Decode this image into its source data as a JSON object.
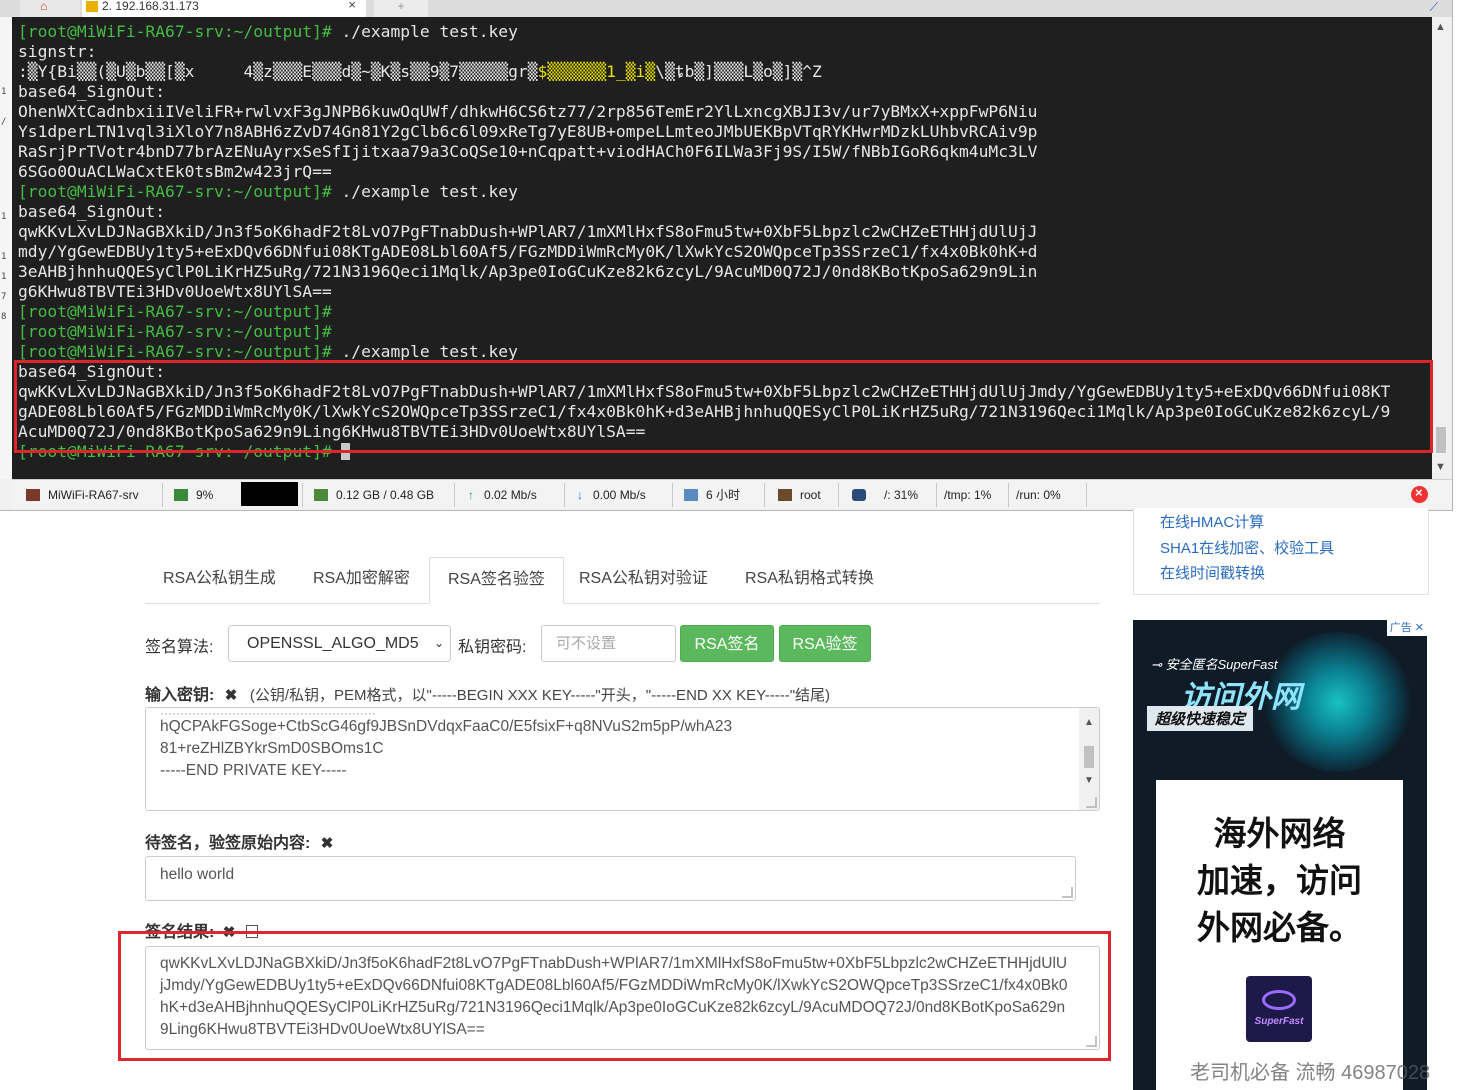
{
  "terminal": {
    "tab_title": "2. 192.168.31.173",
    "new_tab_glyph": "+",
    "lines": [
      [
        {
          "t": "[root@MiWiFi-RA67-srv:~/output]#",
          "c": "prompt"
        },
        {
          "t": " ./example test.key",
          "c": ""
        }
      ],
      [
        {
          "t": "signstr:",
          "c": ""
        }
      ],
      [
        {
          "t": ":▒Y{Bi▒▒(▒U▒b▒▒[▒x     4▒z▒▒▒E▒▒▒d▒~▒K▒s▒▒9▒7▒▒▒▒▒gr▒",
          "c": ""
        },
        {
          "t": "$▒▒▒▒▒▒1_▒i▒",
          "c": "hl"
        },
        {
          "t": "\\▒ȶb▒]▒▒▒L▒o▒]▒^Z",
          "c": ""
        }
      ],
      [
        {
          "t": "base64_SignOut:",
          "c": ""
        }
      ],
      [
        {
          "t": "OhenWXtCadnbxiiIVeliFR+rwlvxF3gJNPB6kuwOqUWf/dhkwH6CS6tz77/2rp856TemEr2YlLxncgXBJI3v/ur7yBMxX+xppFwP6Niu",
          "c": ""
        }
      ],
      [
        {
          "t": "Ys1dperLTN1vql3iXloY7n8ABH6zZvD74Gn81Y2gClb6c6l09xReTg7yE8UB+ompeLLmteoJMbUEKBpVTqRYKHwrMDzkLUhbvRCAiv9p",
          "c": ""
        }
      ],
      [
        {
          "t": "RaSrjPrTVotr4bnD77brAzENuAyrxSeSfIjitxaa79a3CoQSe10+nCqpatt+viodHACh0F6ILWa3Fj9S/I5W/fNBbIGoR6qkm4uMc3LV",
          "c": ""
        }
      ],
      [
        {
          "t": "6SGo0OuACLWaCxtEk0tsBm2w423jrQ==",
          "c": ""
        }
      ],
      [
        {
          "t": "[root@MiWiFi-RA67-srv:~/output]#",
          "c": "prompt"
        },
        {
          "t": " ./example test.key",
          "c": ""
        }
      ],
      [
        {
          "t": "base64_SignOut:",
          "c": ""
        }
      ],
      [
        {
          "t": "qwKKvLXvLDJNaGBXkiD/Jn3f5oK6hadF2t8LvO7PgFTnabDush+WPlAR7/1mXMlHxfS8oFmu5tw+0XbF5Lbpzlc2wCHZeETHHjdUlUjJ",
          "c": ""
        }
      ],
      [
        {
          "t": "mdy/YgGewEDBUy1ty5+eExDQv66DNfui08KTgADE08Lbl60Af5/FGzMDDiWmRcMy0K/lXwkYcS2OWQpceTp3SSrzeC1/fx4x0Bk0hK+d",
          "c": ""
        }
      ],
      [
        {
          "t": "3eAHBjhnhuQQESyClP0LiKrHZ5uRg/721N3196Qeci1Mqlk/Ap3pe0IoGCuKze82k6zcyL/9AcuMD0Q72J/0nd8KBotKpoSa629n9Lin",
          "c": ""
        }
      ],
      [
        {
          "t": "g6KHwu8TBVTEi3HDv0UoeWtx8UYlSA==",
          "c": ""
        }
      ],
      [
        {
          "t": "[root@MiWiFi-RA67-srv:~/output]#",
          "c": "prompt"
        }
      ],
      [
        {
          "t": "[root@MiWiFi-RA67-srv:~/output]#",
          "c": "prompt"
        }
      ],
      [
        {
          "t": "[root@MiWiFi-RA67-srv:~/output]#",
          "c": "prompt"
        },
        {
          "t": " ./example test.key",
          "c": ""
        }
      ],
      [
        {
          "t": "base64_SignOut:",
          "c": ""
        }
      ],
      [
        {
          "t": "qwKKvLXvLDJNaGBXkiD/Jn3f5oK6hadF2t8LvO7PgFTnabDush+WPlAR7/1mXMlHxfS8oFmu5tw+0XbF5Lbpzlc2wCHZeETHHjdUlUjJmdy/YgGewEDBUy1ty5+eExDQv66DNfui08KT",
          "c": ""
        }
      ],
      [
        {
          "t": "gADE08Lbl60Af5/FGzMDDiWmRcMy0K/lXwkYcS2OWQpceTp3SSrzeC1/fx4x0Bk0hK+d3eAHBjhnhuQQESyClP0LiKrHZ5uRg/721N3196Qeci1Mqlk/Ap3pe0IoGCuKze82k6zcyL/9",
          "c": ""
        }
      ],
      [
        {
          "t": "AcuMD0Q72J/0nd8KBotKpoSa629n9Ling6KHwu8TBVTEi3HDv0UoeWtx8UYlSA==",
          "c": ""
        }
      ],
      [
        {
          "t": "[root@MiWiFi-RA67-srv:~/output]#",
          "c": "prompt"
        },
        {
          "t": " ",
          "c": ""
        },
        {
          "t": "",
          "c": "cursor"
        }
      ]
    ],
    "side_digits": [
      "1",
      "/",
      "1",
      "1",
      "1",
      "7",
      "8"
    ],
    "status": {
      "host": "MiWiFi-RA67-srv",
      "cpu": "9%",
      "mem": "0.12 GB / 0.48 GB",
      "upload": "0.02 Mb/s",
      "download": "0.00 Mb/s",
      "uptime": "6 小时",
      "user": "root",
      "disk_root": "/: 31%",
      "disk_tmp": "/tmp: 1%",
      "disk_run": "/run: 0%"
    }
  },
  "side_links": [
    "在线HMAC计算",
    "SHA1在线加密、校验工具",
    "在线时间戳转换"
  ],
  "tabs": [
    "RSA公私钥生成",
    "RSA加密解密",
    "RSA签名验签",
    "RSA公私钥对验证",
    "RSA私钥格式转换"
  ],
  "active_tab": "RSA签名验签",
  "form": {
    "algo_label": "签名算法:",
    "algo_value": "OPENSSL_ALGO_MD5",
    "pw_label": "私钥密码:",
    "pw_placeholder": "可不设置",
    "sign_button": "RSA签名",
    "verify_button": "RSA验签",
    "key_label": "输入密钥:",
    "key_hint": "(公钥/私钥，PEM格式，以\"-----BEGIN XXX KEY-----\"开头，\"-----END XX KEY-----\"结尾)",
    "key_lines": [
      "hQCPAkFGSoge+CtbScG46gf9JBSnDVdqxFaaC0/E5fsixF+q8NVuS2m5pP/whA23",
      "81+reZHlZBYkrSmD0SBOms1C",
      "-----END PRIVATE KEY-----"
    ],
    "content_label": "待签名，验签原始内容:",
    "content_value": "hello world",
    "result_label": "签名结果:",
    "result_lines": [
      "qwKKvLXvLDJNaGBXkiD/Jn3f5oK6hadF2t8LvO7PgFTnabDush+WPlAR7/1mXMlHxfS8oFmu5tw+0XbF5Lbpzlc2wCHZeETHHjdUlU",
      "jJmdy/YgGewEDBUy1ty5+eExDQv66DNfui08KTgADE08Lbl60Af5/FGzMDDiWmRcMy0K/lXwkYcS2OWQpceTp3SSrzeC1/fx4x0Bk0",
      "hK+d3eAHBjhnhuQQESyClP0LiKrHZ5uRg/721N3196Qeci1Mqlk/Ap3pe0IoGCuKze82k6zcyL/9AcuMDOQ72J/0nd8KBotKpoSa629n",
      "9Ling6KHwu8TBVTEi3HDv0UoeWtx8UYlSA=="
    ]
  },
  "ad": {
    "badge": "广告",
    "line1": "安全匿名SuperFast",
    "line2": "访问外网",
    "line3": "超级快速稳定",
    "card_text": "海外网络\n加速，访问\n外网必备。",
    "logo_name": "SuperFast"
  },
  "watermark": "老司机必备 流畅 46987028"
}
